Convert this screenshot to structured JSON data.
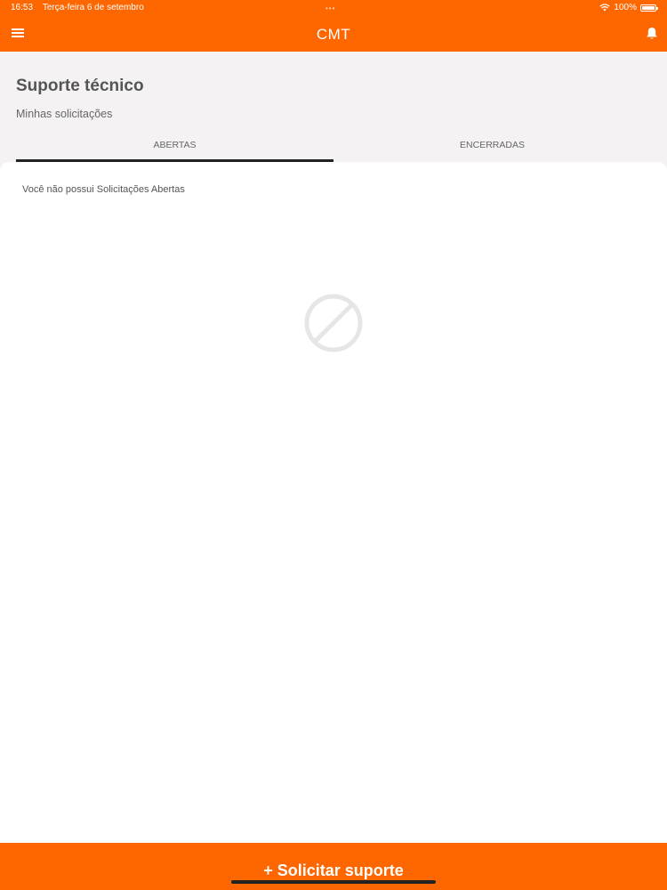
{
  "status_bar": {
    "time": "16:53",
    "date": "Terça-feira 6 de setembro",
    "multitask_dots": "•••",
    "battery_text": "100%"
  },
  "header": {
    "title": "CMT",
    "menu_icon": "hamburger-menu-icon",
    "bell_icon": "bell-icon"
  },
  "page": {
    "title": "Suporte técnico",
    "subtitle": "Minhas solicitações"
  },
  "tabs": [
    {
      "label": "ABERTAS",
      "active": true
    },
    {
      "label": "ENCERRADAS",
      "active": false
    }
  ],
  "content": {
    "empty_message": "Você não possui Solicitações Abertas",
    "empty_icon": "no-entry-icon"
  },
  "footer": {
    "button_label": "+ Solicitar suporte"
  },
  "colors": {
    "accent": "#fe6600",
    "background": "#f4f2f2",
    "tab_indicator": "#222222"
  }
}
